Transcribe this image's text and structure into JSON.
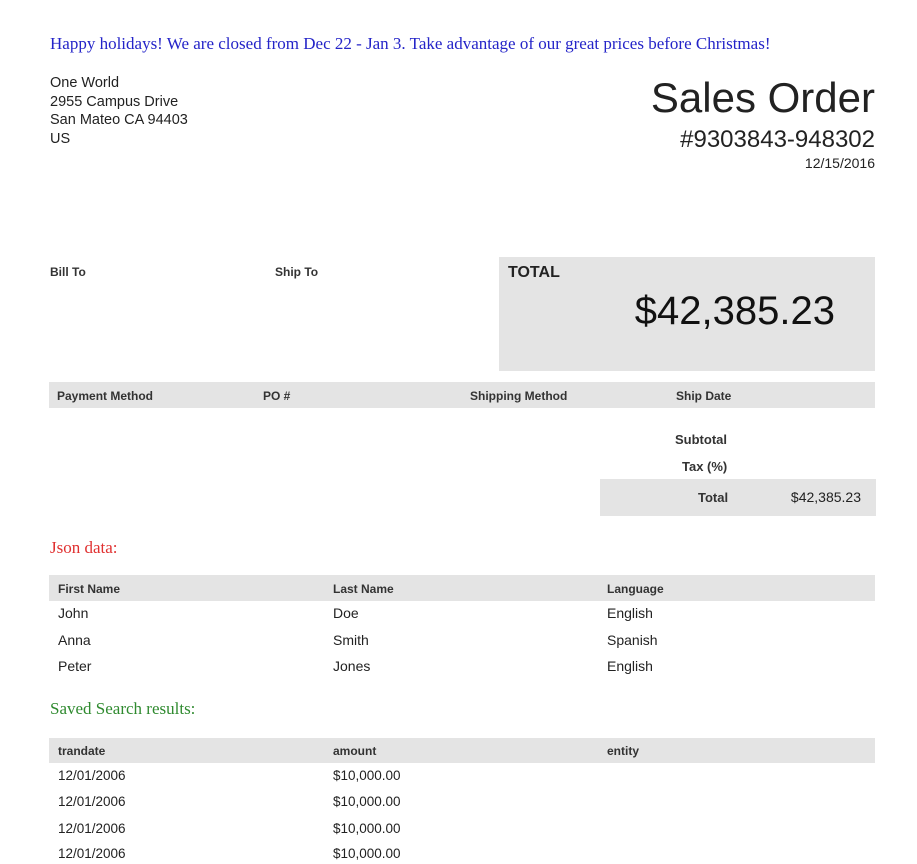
{
  "banner": "Happy holidays! We are closed from Dec 22 - Jan 3. Take advantage of our great prices before Christmas!",
  "company": {
    "name": "One World",
    "street": "2955 Campus Drive",
    "city_line": "San Mateo CA 94403",
    "country": "US"
  },
  "document": {
    "title": "Sales Order",
    "number": "#9303843-948302",
    "date": "12/15/2016"
  },
  "labels": {
    "bill_to": "Bill To",
    "ship_to": "Ship To",
    "total": "TOTAL"
  },
  "total_amount": "$42,385.23",
  "order_info_headers": [
    "Payment Method",
    "PO #",
    "Shipping Method",
    "Ship Date"
  ],
  "summary": {
    "subtotal_label": "Subtotal",
    "tax_label": "Tax (%)",
    "total_label": "Total",
    "total_value": "$42,385.23"
  },
  "json_section": {
    "title": "Json data:",
    "headers": [
      "First Name",
      "Last Name",
      "Language"
    ],
    "rows": [
      [
        "John",
        "Doe",
        "English"
      ],
      [
        "Anna",
        "Smith",
        "Spanish"
      ],
      [
        "Peter",
        "Jones",
        "English"
      ]
    ]
  },
  "saved_search": {
    "title": "Saved Search results:",
    "headers": [
      "trandate",
      "amount",
      "entity"
    ],
    "rows": [
      [
        "12/01/2006",
        "$10,000.00",
        ""
      ],
      [
        "12/01/2006",
        "$10,000.00",
        ""
      ],
      [
        "12/01/2006",
        "$10,000.00",
        ""
      ],
      [
        "12/01/2006",
        "$10,000.00",
        ""
      ]
    ]
  }
}
